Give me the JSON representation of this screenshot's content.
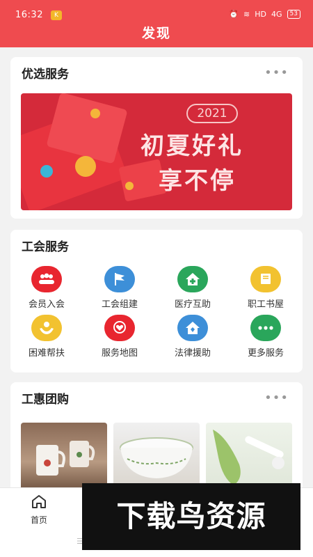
{
  "status_bar": {
    "time": "16:32",
    "network": "4G",
    "battery": "53"
  },
  "header": {
    "title": "发现"
  },
  "featured": {
    "title": "优选服务",
    "banner": {
      "year": "2021",
      "line1": "初夏好礼",
      "line2": "享不停"
    }
  },
  "union": {
    "title": "工会服务",
    "items": [
      {
        "label": "会员入会",
        "icon": "people-icon",
        "color": "#e8262f"
      },
      {
        "label": "工会组建",
        "icon": "flag-icon",
        "color": "#3d8fd8"
      },
      {
        "label": "医疗互助",
        "icon": "medical-home-icon",
        "color": "#2aa65b"
      },
      {
        "label": "职工书屋",
        "icon": "book-icon",
        "color": "#f2c230"
      },
      {
        "label": "困难帮扶",
        "icon": "helping-hands-icon",
        "color": "#f2c230"
      },
      {
        "label": "服务地图",
        "icon": "map-heart-icon",
        "color": "#e8262f"
      },
      {
        "label": "法律援助",
        "icon": "law-home-icon",
        "color": "#3d8fd8"
      },
      {
        "label": "更多服务",
        "icon": "more-icon",
        "color": "#2aa65b"
      }
    ]
  },
  "groupbuy": {
    "title": "工惠团购"
  },
  "bottom_nav": {
    "home_label": "首页"
  },
  "watermark": "下载鸟资源"
}
